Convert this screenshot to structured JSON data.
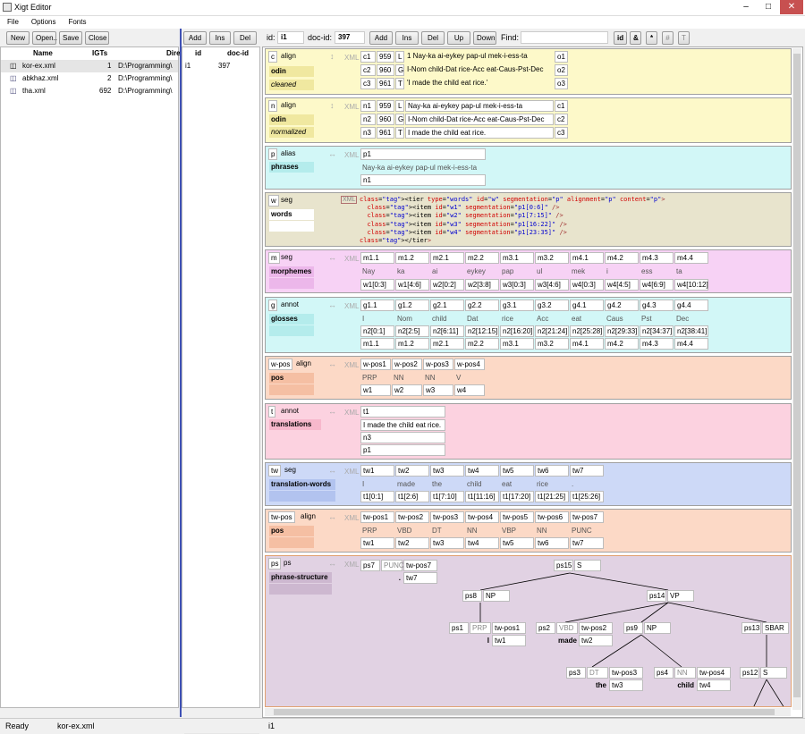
{
  "window": {
    "title": "Xigt Editor"
  },
  "menu": [
    "File",
    "Options",
    "Fonts"
  ],
  "left": {
    "buttons": [
      "New",
      "Open..",
      "Save",
      "Close"
    ],
    "columns": [
      "Name",
      "IGTs",
      "Dire"
    ],
    "files": [
      {
        "name": "kor-ex.xml",
        "igts": "1",
        "dir": "D:\\Programming\\"
      },
      {
        "name": "abkhaz.xml",
        "igts": "2",
        "dir": "D:\\Programming\\"
      },
      {
        "name": "tha.xml",
        "igts": "692",
        "dir": "D:\\Programming\\"
      }
    ]
  },
  "mid": {
    "buttons": [
      "Add",
      "Ins",
      "Del"
    ],
    "columns": [
      "id",
      "doc-id"
    ],
    "rows": [
      {
        "id": "i1",
        "doc": "397"
      }
    ]
  },
  "top": {
    "id_label": "id:",
    "id": "i1",
    "doc_label": "doc-id:",
    "doc": "397",
    "buttons": [
      "Add",
      "Ins",
      "Del",
      "Up",
      "Down"
    ],
    "find_label": "Find:",
    "toggles": [
      "id",
      "&",
      "*",
      "#",
      "T"
    ]
  },
  "tiers": {
    "c": {
      "id": "c",
      "type": "align",
      "name": "odin",
      "sub": "cleaned",
      "rows": [
        [
          "c1",
          "959",
          "L",
          "1 Nay-ka ai-eykey pap-ul mek-i-ess-ta",
          "o1"
        ],
        [
          "c2",
          "960",
          "G",
          "I-Nom child-Dat rice-Acc eat-Caus-Pst-Dec",
          "o2"
        ],
        [
          "c3",
          "961",
          "T",
          "'I made the child eat rice.'",
          "o3"
        ]
      ]
    },
    "n": {
      "id": "n",
      "type": "align",
      "name": "odin",
      "sub": "normalized",
      "rows": [
        [
          "n1",
          "959",
          "L",
          "Nay-ka ai-eykey pap-ul mek-i-ess-ta",
          "c1"
        ],
        [
          "n2",
          "960",
          "G",
          "I-Nom child-Dat rice-Acc eat-Caus-Pst-Dec",
          "c2"
        ],
        [
          "n3",
          "961",
          "T",
          "I made the child eat rice.",
          "c3"
        ]
      ]
    },
    "p": {
      "id": "p",
      "type": "alias",
      "name": "phrases",
      "cells": [
        "p1",
        "Nay-ka ai-eykey pap-ul mek-i-ess-ta",
        "n1"
      ]
    },
    "w": {
      "id": "w",
      "type": "seg",
      "name": "words",
      "xml": "<tier type=\"words\" id=\"w\" segmentation=\"p\" alignment=\"p\" content=\"p\">\n  <item id=\"w1\" segmentation=\"p1[0:6]\" />\n  <item id=\"w2\" segmentation=\"p1[7:15]\" />\n  <item id=\"w3\" segmentation=\"p1[16:22]\" />\n  <item id=\"w4\" segmentation=\"p1[23:35]\" />\n</tier>"
    },
    "m": {
      "id": "m",
      "type": "seg",
      "name": "morphemes",
      "ids": [
        "m1.1",
        "m1.2",
        "m2.1",
        "m2.2",
        "m3.1",
        "m3.2",
        "m4.1",
        "m4.2",
        "m4.3",
        "m4.4"
      ],
      "vals": [
        "Nay",
        "ka",
        "ai",
        "eykey",
        "pap",
        "ul",
        "mek",
        "i",
        "ess",
        "ta"
      ],
      "refs": [
        "w1[0:3]",
        "w1[4:6]",
        "w2[0:2]",
        "w2[3:8]",
        "w3[0:3]",
        "w3[4:6]",
        "w4[0:3]",
        "w4[4:5]",
        "w4[6:9]",
        "w4[10:12]"
      ]
    },
    "g": {
      "id": "g",
      "type": "annot",
      "name": "glosses",
      "ids": [
        "g1.1",
        "g1.2",
        "g2.1",
        "g2.2",
        "g3.1",
        "g3.2",
        "g4.1",
        "g4.2",
        "g4.3",
        "g4.4"
      ],
      "vals": [
        "I",
        "Nom",
        "child",
        "Dat",
        "rice",
        "Acc",
        "eat",
        "Caus",
        "Pst",
        "Dec"
      ],
      "segs": [
        "n2[0:1]",
        "n2[2:5]",
        "n2[6:11]",
        "n2[12:15]",
        "n2[16:20]",
        "n2[21:24]",
        "n2[25:28]",
        "n2[29:33]",
        "n2[34:37]",
        "n2[38:41]"
      ],
      "refs": [
        "m1.1",
        "m1.2",
        "m2.1",
        "m2.2",
        "m3.1",
        "m3.2",
        "m4.1",
        "m4.2",
        "m4.3",
        "m4.4"
      ]
    },
    "wpos": {
      "id": "w-pos",
      "type": "align",
      "name": "pos",
      "ids": [
        "w-pos1",
        "w-pos2",
        "w-pos3",
        "w-pos4"
      ],
      "vals": [
        "PRP",
        "NN",
        "NN",
        "V"
      ],
      "refs": [
        "w1",
        "w2",
        "w3",
        "w4"
      ]
    },
    "t": {
      "id": "t",
      "type": "annot",
      "name": "translations",
      "cells": [
        "t1",
        "I made the child eat rice.",
        "n3",
        "p1"
      ]
    },
    "tw": {
      "id": "tw",
      "type": "seg",
      "name": "translation-words",
      "ids": [
        "tw1",
        "tw2",
        "tw3",
        "tw4",
        "tw5",
        "tw6",
        "tw7"
      ],
      "vals": [
        "I",
        "made",
        "the",
        "child",
        "eat",
        "rice",
        "."
      ],
      "refs": [
        "t1[0:1]",
        "t1[2:6]",
        "t1[7:10]",
        "t1[11:16]",
        "t1[17:20]",
        "t1[21:25]",
        "t1[25:26]"
      ]
    },
    "twpos": {
      "id": "tw-pos",
      "type": "align",
      "name": "pos",
      "ids": [
        "tw-pos1",
        "tw-pos2",
        "tw-pos3",
        "tw-pos4",
        "tw-pos5",
        "tw-pos6",
        "tw-pos7"
      ],
      "vals": [
        "PRP",
        "VBD",
        "DT",
        "NN",
        "VBP",
        "NN",
        "PUNC"
      ],
      "refs": [
        "tw1",
        "tw2",
        "tw3",
        "tw4",
        "tw5",
        "tw6",
        "tw7"
      ]
    },
    "ps": {
      "id": "ps",
      "type": "ps",
      "name": "phrase-structure"
    }
  },
  "tree": {
    "nodes": [
      {
        "k": "ps7",
        "lab": "PUNC",
        "ref": "tw-pos7",
        "word": ".",
        "wr": "tw7"
      },
      {
        "k": "ps15",
        "lab": "S"
      },
      {
        "k": "ps8",
        "lab": "NP"
      },
      {
        "k": "ps14",
        "lab": "VP"
      },
      {
        "k": "ps1",
        "lab": "PRP",
        "ref": "tw-pos1",
        "word": "I",
        "wr": "tw1"
      },
      {
        "k": "ps2",
        "lab": "VBD",
        "ref": "tw-pos2",
        "word": "made",
        "wr": "tw2"
      },
      {
        "k": "ps9",
        "lab": "NP"
      },
      {
        "k": "ps13",
        "lab": "SBAR"
      },
      {
        "k": "ps3",
        "lab": "DT",
        "ref": "tw-pos3",
        "word": "the",
        "wr": "tw3"
      },
      {
        "k": "ps4",
        "lab": "NN",
        "ref": "tw-pos4",
        "word": "child",
        "wr": "tw4"
      },
      {
        "k": "ps12",
        "lab": "S"
      }
    ]
  },
  "status": {
    "left": "Ready",
    "file": "kor-ex.xml",
    "igt": "i1"
  },
  "labels": {
    "xml": "XML"
  }
}
